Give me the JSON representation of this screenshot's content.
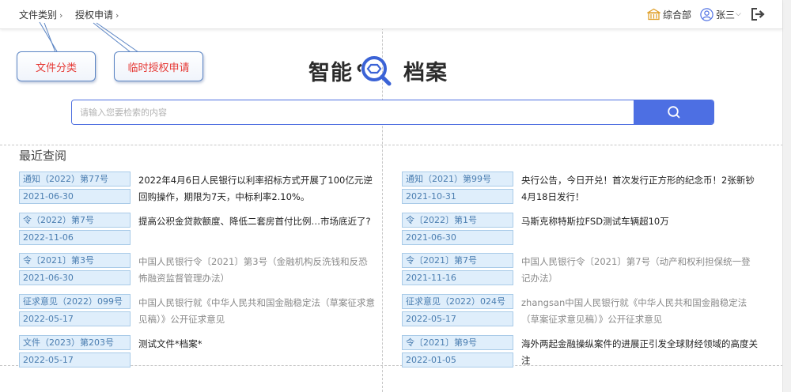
{
  "header": {
    "nav": [
      {
        "label": "文件类别"
      },
      {
        "label": "授权申请"
      }
    ],
    "chevron": "›",
    "department": "综合部",
    "user_name": "张三",
    "user_caret": "⌵",
    "icons": {
      "department": "building-icon",
      "user": "user-avatar-icon",
      "logout": "logout-icon"
    }
  },
  "callouts": [
    {
      "label": "文件分类"
    },
    {
      "label": "临时授权申请"
    }
  ],
  "logo": {
    "text_left": "智能",
    "text_right": "档案"
  },
  "search": {
    "placeholder": "请输入您要检索的内容",
    "value": ""
  },
  "recent": {
    "title": "最近查阅",
    "left": [
      {
        "doc_no": "通知（2022）第77号",
        "date": "2021-06-30",
        "text": "2022年4月6日人民银行以利率招标方式开展了100亿元逆回购操作，期限为7天，中标利率2.10%。",
        "muted": false
      },
      {
        "doc_no": "令（2022）第7号",
        "date": "2022-11-06",
        "text": "提高公积金贷款额度、降低二套房首付比例…市场底近了?",
        "muted": false
      },
      {
        "doc_no": "令〔2021〕第3号",
        "date": "2021-06-30",
        "text": "中国人民银行令〔2021〕第3号（金融机构反洗钱和反恐怖融资监督管理办法）",
        "muted": true
      },
      {
        "doc_no": "征求意见（2022）099号",
        "date": "2022-05-17",
        "text": "中国人民银行就《中华人民共和国金融稳定法（草案征求意见稿）》公开征求意见",
        "muted": true
      },
      {
        "doc_no": "文件（2023）第203号",
        "date": "2022-05-17",
        "text": "测试文件*档案*",
        "muted": false
      }
    ],
    "right": [
      {
        "doc_no": "通知（2021）第99号",
        "date": "2021-10-31",
        "text": "央行公告，今日开兑！首次发行正方形的纪念币！2张新钞4月18日发行！",
        "muted": false
      },
      {
        "doc_no": "令〔2022〕第1号",
        "date": "2021-06-30",
        "text": "马斯克称特斯拉FSD测试车辆超10万",
        "muted": false
      },
      {
        "doc_no": "令〔2021〕第7号",
        "date": "2021-11-16",
        "text": "中国人民银行令〔2021〕第7号（动产和权利担保统一登记办法）",
        "muted": true
      },
      {
        "doc_no": "征求意见（2022）024号",
        "date": "2022-05-17",
        "text": "zhangsan中国人民银行就《中华人民共和国金融稳定法（草案征求意见稿）》公开征求意见",
        "muted": true
      },
      {
        "doc_no": "令〔2021〕第9号",
        "date": "2022-01-05",
        "text": "海外两起金融操纵案件的进展正引发全球财经领域的高度关注",
        "muted": false
      }
    ]
  }
}
